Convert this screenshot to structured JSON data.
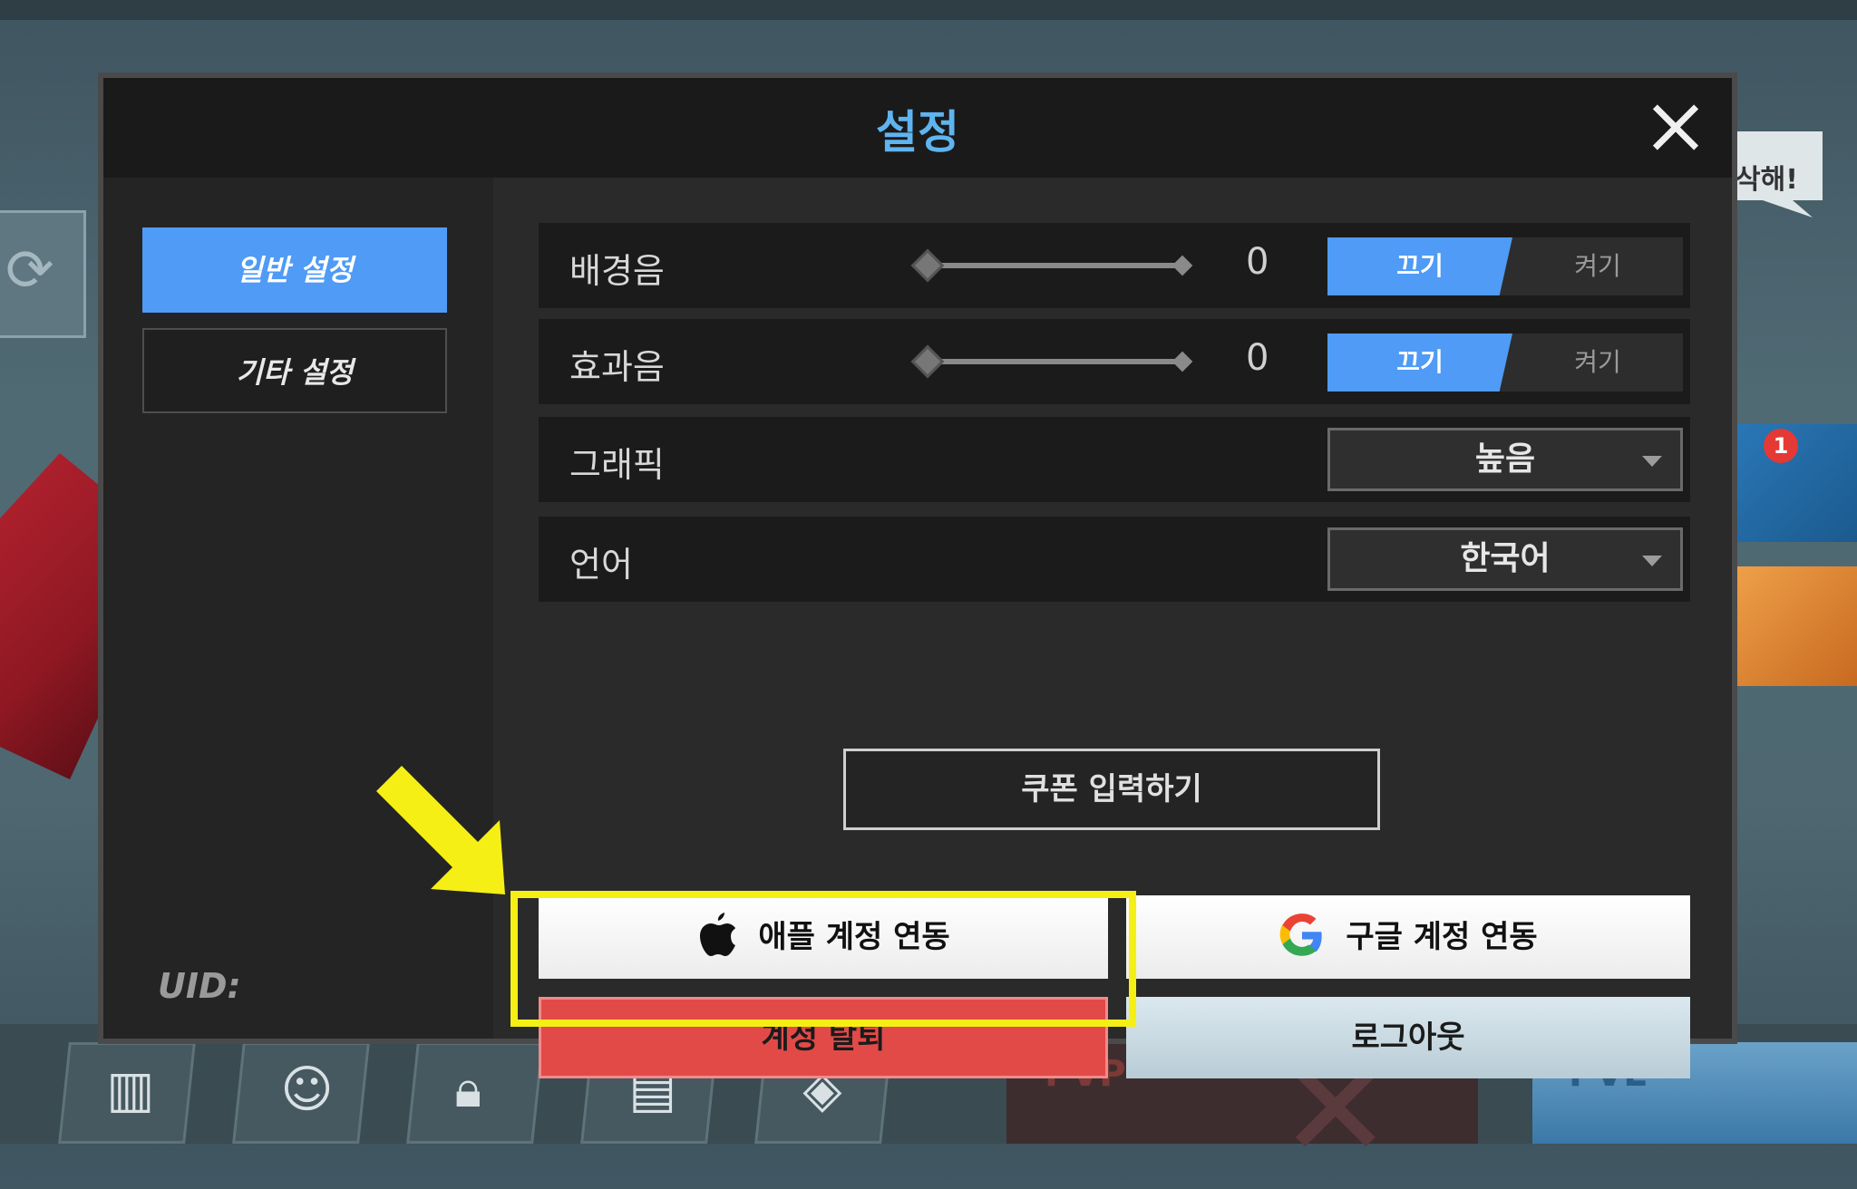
{
  "modal": {
    "title": "설정",
    "close_icon": "close-icon"
  },
  "sidebar": {
    "tabs": [
      {
        "label": "일반 설정",
        "active": true
      },
      {
        "label": "기타 설정",
        "active": false
      }
    ],
    "uid_label": "UID:"
  },
  "settings": {
    "bgm": {
      "label": "배경음",
      "value": "0",
      "toggle_on": "끄기",
      "toggle_off": "켜기"
    },
    "sfx": {
      "label": "효과음",
      "value": "0",
      "toggle_on": "끄기",
      "toggle_off": "켜기"
    },
    "graphics": {
      "label": "그래픽",
      "selected": "높음"
    },
    "language": {
      "label": "언어",
      "selected": "한국어"
    }
  },
  "buttons": {
    "coupon": "쿠폰 입력하기",
    "apple_link": "애플 계정 연동",
    "google_link": "구글 계정 연동",
    "delete_account": "계정 탈퇴",
    "logout": "로그아웃"
  },
  "background": {
    "speech_text": "삭해!",
    "badge_count": "1",
    "mode_pvp_tag": "PVP",
    "mode_pve_tag": "PVE"
  },
  "colors": {
    "accent_blue": "#4f9bf5",
    "title_blue": "#5fb4f0",
    "danger_red": "#e24a47",
    "highlight_yellow": "#f5ef16"
  }
}
